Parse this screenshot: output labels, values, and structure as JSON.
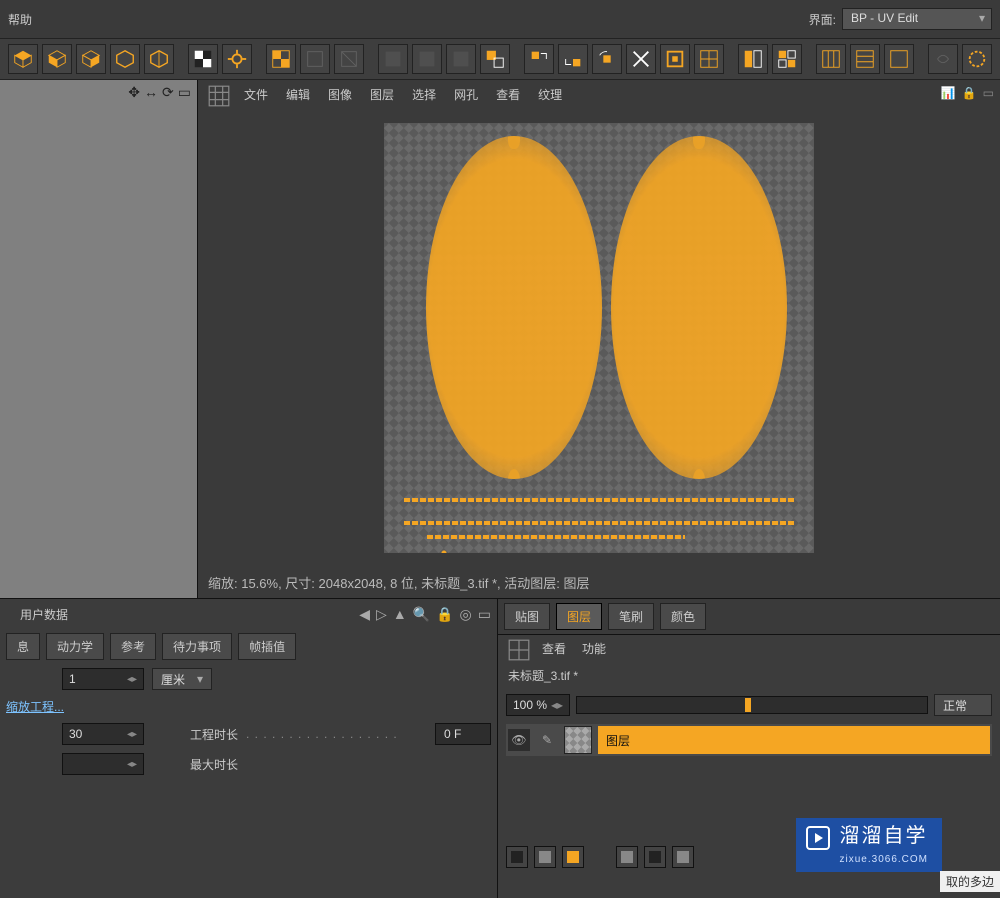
{
  "menubar": {
    "help": "帮助"
  },
  "layout": {
    "label": "界面:",
    "value": "BP - UV Edit"
  },
  "uv_menu": {
    "items": [
      "文件",
      "编辑",
      "图像",
      "图层",
      "选择",
      "网孔",
      "查看",
      "纹理"
    ]
  },
  "uv_status": "缩放: 15.6%, 尺寸: 2048x2048, 8 位, 未标题_3.tif *, 活动图层: 图层",
  "attr": {
    "header": [
      "",
      "用户数据"
    ],
    "tabs": [
      "息",
      "动力学",
      "参考",
      "待力事项",
      "帧插值"
    ],
    "row1_value": "1",
    "row1_unit": "厘米",
    "scale_link": "缩放工程...",
    "row2_value": "30",
    "row2_label": "工程时长",
    "row2_out": "0 F",
    "row3_label": "最大时长"
  },
  "layers": {
    "tabs": [
      "贴图",
      "图层",
      "笔刷",
      "颜色"
    ],
    "active_tab_index": 1,
    "submenu": [
      "查看",
      "功能"
    ],
    "title": "未标题_3.tif *",
    "zoom": "100 %",
    "blend": "正常",
    "layer_name": "图层"
  },
  "watermark": {
    "title": "溜溜自学",
    "sub": "zixue.3066.COM"
  },
  "tooltip": "取的多边"
}
